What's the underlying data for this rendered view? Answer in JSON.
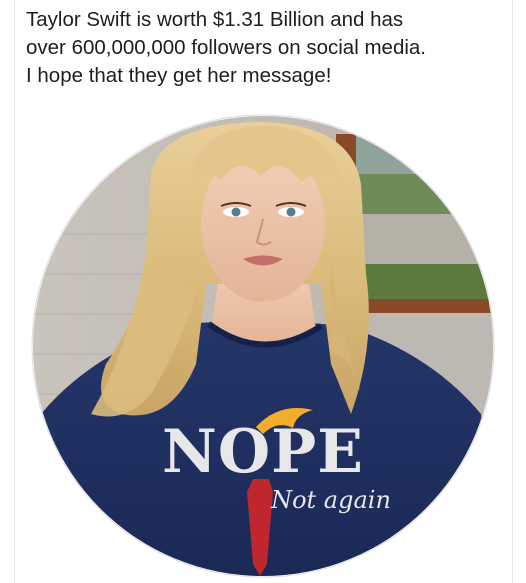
{
  "post": {
    "text_lines": [
      "Taylor Swift is worth $1.31 Billion and has",
      "over 600,000,000 followers on social media.",
      "I hope that they get her message!"
    ]
  },
  "image": {
    "shirt_text_main": "NOPE",
    "shirt_text_sub": "Not again"
  },
  "colors": {
    "text": "#1c1e21",
    "shirt": "#1f2f63",
    "tie": "#c0262d",
    "hair": "#f2ad2c"
  }
}
